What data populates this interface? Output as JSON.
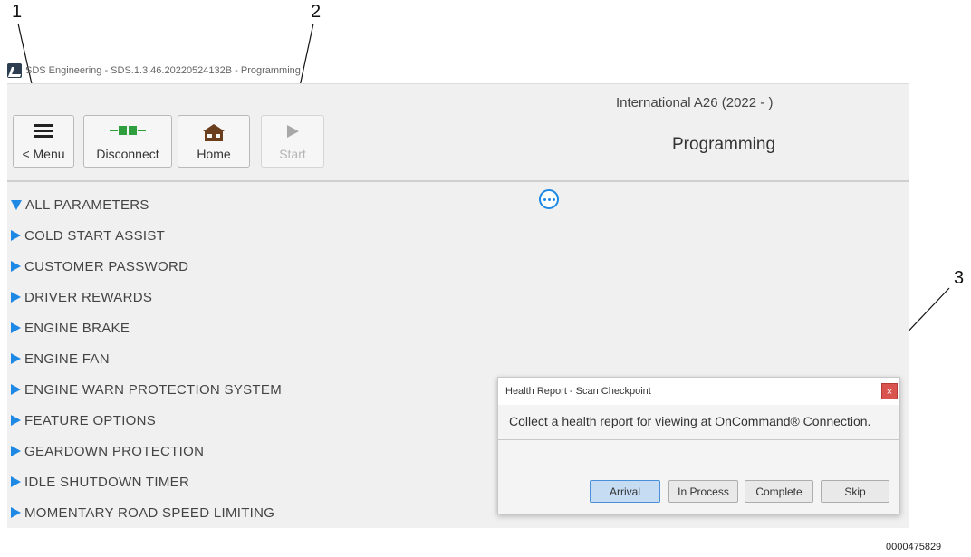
{
  "callouts": [
    "1",
    "2",
    "3"
  ],
  "window_title": "SDS Engineering - SDS.1.3.46.20220524132B - Programming",
  "toolbar": {
    "menu_label": "< Menu",
    "disconnect_label": "Disconnect",
    "home_label": "Home",
    "start_label": "Start"
  },
  "header": {
    "vehicle": "International A26 (2022 - )",
    "page_title": "Programming"
  },
  "parameters": {
    "root": "ALL PARAMETERS",
    "items": [
      "COLD START ASSIST",
      "CUSTOMER PASSWORD",
      "DRIVER REWARDS",
      "ENGINE BRAKE",
      "ENGINE FAN",
      "ENGINE WARN PROTECTION SYSTEM",
      "FEATURE OPTIONS",
      "GEARDOWN PROTECTION",
      "IDLE SHUTDOWN TIMER",
      "MOMENTARY ROAD SPEED LIMITING"
    ]
  },
  "dialog": {
    "title": "Health Report - Scan Checkpoint",
    "close": "×",
    "message": "Collect a health report for viewing at OnCommand® Connection.",
    "buttons": {
      "arrival": "Arrival",
      "in_process": "In Process",
      "complete": "Complete",
      "skip": "Skip"
    }
  },
  "figure_id": "0000475829",
  "colors": {
    "accent": "#1e88e5",
    "disconnect_icon": "#2e9e3e",
    "home_icon": "#6b3f1e",
    "close": "#d9534f"
  },
  "icons": {
    "menu": "hamburger-icon",
    "disconnect": "connector-icon",
    "home": "house-icon",
    "start": "play-icon",
    "more": "more-options-icon"
  }
}
